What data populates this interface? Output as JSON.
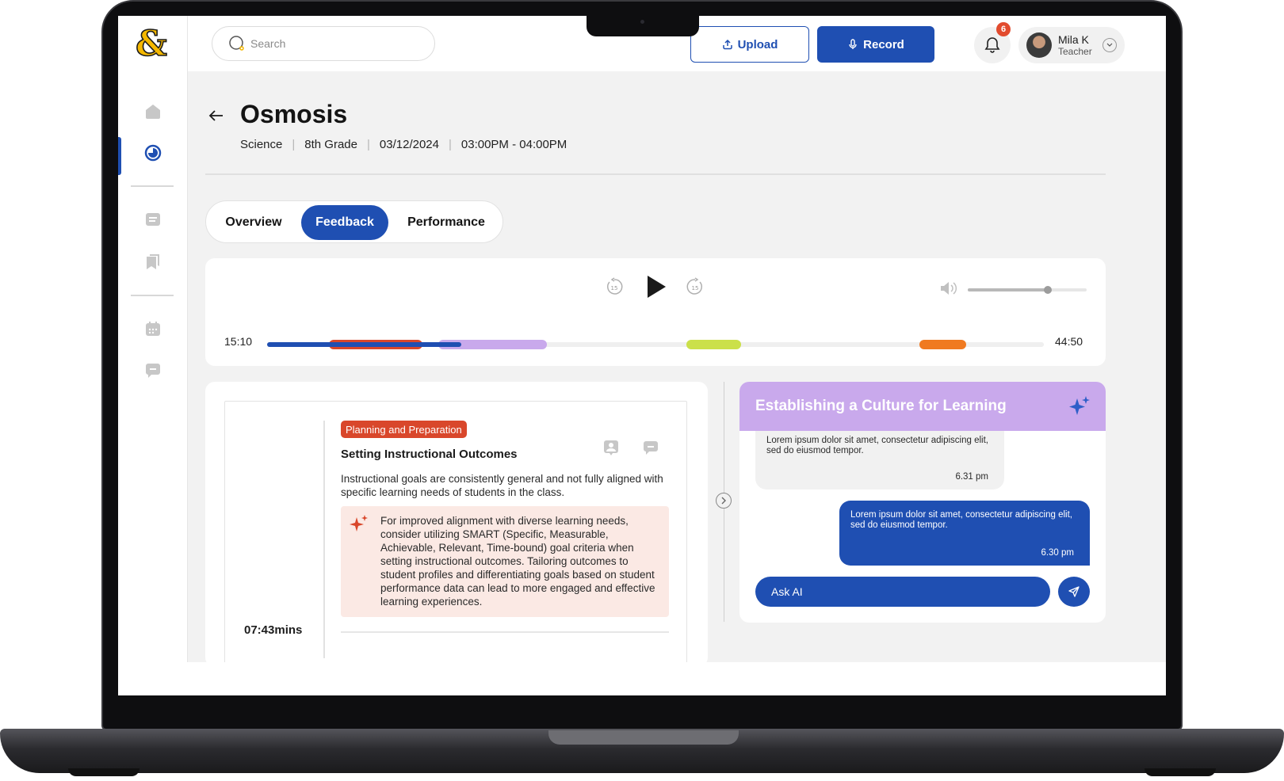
{
  "app": {
    "logo_icon": "ampersand-logo-icon"
  },
  "colors": {
    "primary": "#1f4fb2",
    "danger": "#d9472b",
    "accent_purple": "#c9a9ec",
    "lime": "#cbe04a",
    "orange": "#f07a20"
  },
  "sidebar": {
    "items": [
      {
        "icon": "home-icon",
        "active": false
      },
      {
        "icon": "sessions-icon",
        "active": true
      },
      {
        "icon": "notes-icon",
        "active": false
      },
      {
        "icon": "bookmarks-icon",
        "active": false
      },
      {
        "icon": "calendar-icon",
        "active": false
      },
      {
        "icon": "messages-icon",
        "active": false
      }
    ]
  },
  "topbar": {
    "search_placeholder": "Search",
    "upload_label": "Upload",
    "record_label": "Record",
    "notification_count": "6",
    "user_name": "Mila K",
    "user_role": "Teacher"
  },
  "lesson": {
    "title": "Osmosis",
    "subject": "Science",
    "grade": "8th Grade",
    "date": "03/12/2024",
    "time": "03:00PM - 04:00PM"
  },
  "tabs": [
    {
      "label": "Overview",
      "active": false
    },
    {
      "label": "Feedback",
      "active": true
    },
    {
      "label": "Performance",
      "active": false
    }
  ],
  "player": {
    "current_time": "15:10",
    "total_time": "44:50",
    "rewind_label": "15",
    "forward_label": "15",
    "volume_level": 0.67,
    "progress_fraction": 0.25,
    "segments": [
      {
        "color": "#d9472b",
        "start": 0.08,
        "end": 0.2
      },
      {
        "color": "#c9a9ec",
        "start": 0.22,
        "end": 0.36
      },
      {
        "color": "#cbe04a",
        "start": 0.54,
        "end": 0.61
      },
      {
        "color": "#f07a20",
        "start": 0.84,
        "end": 0.9
      }
    ]
  },
  "feedback": {
    "timestamp": "07:43mins",
    "tag": "Planning and Preparation",
    "title": "Setting Instructional Outcomes",
    "description": "Instructional goals are consistently general and not fully aligned with specific learning needs of students in the class.",
    "ai_suggestion": "For improved alignment with diverse learning needs, consider utilizing SMART (Specific, Measurable, Achievable, Relevant, Time-bound) goal criteria when setting instructional outcomes. Tailoring outcomes to student profiles and differentiating goals based on student performance data can lead to more engaged and effective learning experiences."
  },
  "chat": {
    "title": "Establishing a Culture for Learning",
    "messages": [
      {
        "from": "ai",
        "text": "Lorem ipsum dolor sit amet, consectetur adipiscing elit, sed do eiusmod tempor.",
        "time": "6.31 pm"
      },
      {
        "from": "user",
        "text": "Lorem ipsum dolor sit amet, consectetur adipiscing elit, sed do eiusmod tempor.",
        "time": "6.30 pm"
      }
    ],
    "input_placeholder": "Ask AI"
  }
}
